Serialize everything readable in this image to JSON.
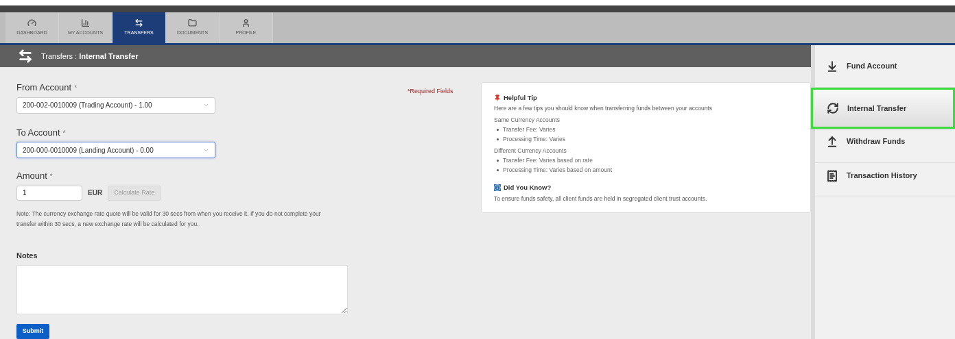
{
  "tabs": [
    {
      "label": "DASHBOARD",
      "selected": false
    },
    {
      "label": "MY ACCOUNTS",
      "selected": false
    },
    {
      "label": "TRANSFERS",
      "selected": true
    },
    {
      "label": "DOCUMENTS",
      "selected": false
    },
    {
      "label": "PROFILE",
      "selected": false
    }
  ],
  "header": {
    "section": "Transfers :",
    "title": "Internal Transfer"
  },
  "form": {
    "required_note": "*Required Fields",
    "from": {
      "label": "From Account",
      "required_mark": "*",
      "value": "200-002-0010009 (Trading Account) - 1.00",
      "focused": false
    },
    "to": {
      "label": "To Account",
      "required_mark": "*",
      "value": "200-000-0010009 (Landing Account) - 0.00",
      "focused": true
    },
    "amount": {
      "label": "Amount",
      "required_mark": "*",
      "value": "1",
      "currency": "EUR",
      "button": "Calculate Rate"
    },
    "note": "Note: The currency exchange rate quote will be valid for 30 secs from when you receive it. If you do not complete your transfer within 30 secs, a new exchange rate will be calculated for you.",
    "notes_label": "Notes",
    "submit": "Submit"
  },
  "tip": {
    "title": "Helpful Tip",
    "intro": "Here are a few tips you should know when transferring funds between your accounts",
    "groups": [
      {
        "heading": "Same Currency Accounts",
        "items": [
          "Transfer Fee: Varies",
          "Processing Time: Varies"
        ]
      },
      {
        "heading": "Different Currency Accounts",
        "items": [
          "Transfer Fee: Varies based on rate",
          "Processing Time: Varies based on amount"
        ]
      }
    ],
    "know_title": "Did You Know?",
    "know_text": "To ensure funds safety, all client funds are held in segregated client trust accounts."
  },
  "sidebar": {
    "items": [
      {
        "label": "Fund Account",
        "selected": false
      },
      {
        "label": "Internal Transfer",
        "selected": true
      },
      {
        "label": "Withdraw Funds",
        "selected": false
      },
      {
        "label": "Transaction History",
        "selected": false
      }
    ]
  }
}
